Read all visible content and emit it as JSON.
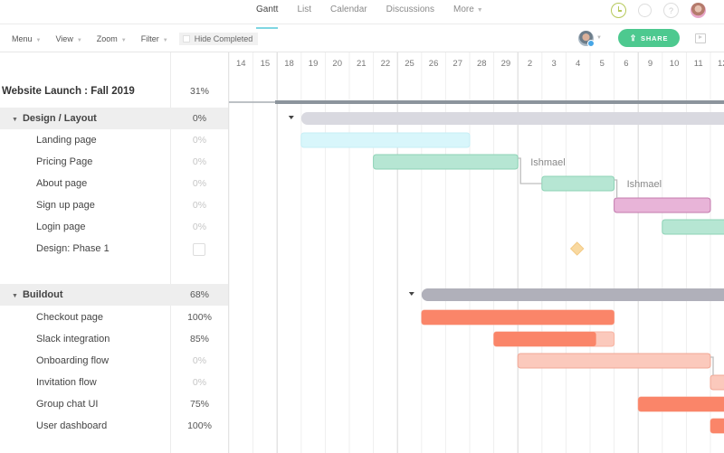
{
  "nav": {
    "tabs": [
      {
        "label": "Gantt",
        "active": true
      },
      {
        "label": "List",
        "active": false
      },
      {
        "label": "Calendar",
        "active": false
      },
      {
        "label": "Discussions",
        "active": false
      },
      {
        "label": "More",
        "active": false,
        "dropdown": true
      }
    ],
    "icons": [
      "clock-icon",
      "search-icon",
      "help-icon",
      "user-avatar"
    ],
    "help_glyph": "?"
  },
  "toolbar": {
    "menus": [
      "Menu",
      "View",
      "Zoom",
      "Filter"
    ],
    "hide_completed_label": "Hide Completed",
    "hide_completed_checked": false,
    "share_label": "SHARE",
    "share_color": "#4dc98f"
  },
  "timeline": {
    "days": [
      "14",
      "15",
      "18",
      "19",
      "20",
      "21",
      "22",
      "25",
      "26",
      "27",
      "28",
      "29",
      "2",
      "3",
      "4",
      "5",
      "6",
      "9",
      "10",
      "11",
      "12"
    ],
    "week_starts": [
      2,
      7,
      12,
      17
    ]
  },
  "project": {
    "name": "Website Launch : Fall 2019",
    "percent": "31%"
  },
  "groups": [
    {
      "name": "Design / Layout",
      "percent": "0%",
      "bar": {
        "start": 3,
        "end": 21,
        "color": "#d9d9e0"
      },
      "tasks": [
        {
          "name": "Landing page",
          "percent": "0%",
          "muted": true,
          "bar": {
            "start": 3,
            "end": 10,
            "fill": "#d8f6fb",
            "stroke": "#c6eef6",
            "progress": 0
          }
        },
        {
          "name": "Pricing Page",
          "percent": "0%",
          "muted": true,
          "bar": {
            "start": 6,
            "end": 12,
            "fill": "#b6e6d3",
            "stroke": "#8dd3b6",
            "progress": 0
          },
          "assignee": "Ishmael"
        },
        {
          "name": "About page",
          "percent": "0%",
          "muted": true,
          "bar": {
            "start": 13,
            "end": 16,
            "fill": "#b6e6d3",
            "stroke": "#8dd3b6",
            "progress": 0
          },
          "assignee": "Ishmael"
        },
        {
          "name": "Sign up page",
          "percent": "0%",
          "muted": true,
          "bar": {
            "start": 16,
            "end": 20,
            "fill": "#e8b4d8",
            "stroke": "#c37aad",
            "progress": 0
          }
        },
        {
          "name": "Login page",
          "percent": "0%",
          "muted": true,
          "bar": {
            "start": 18,
            "end": 21,
            "fill": "#b6e6d3",
            "stroke": "#8dd3b6",
            "progress": 0
          }
        },
        {
          "name": "Design: Phase 1",
          "percent": "",
          "milestone": true,
          "milestone_day": 14.5,
          "milestone_color": "#f9d9a0"
        }
      ]
    },
    {
      "name": "Buildout",
      "percent": "68%",
      "bar": {
        "start": 8,
        "end": 21,
        "color": "#b0b0ba"
      },
      "tasks": [
        {
          "name": "Checkout page",
          "percent": "100%",
          "muted": false,
          "bar": {
            "start": 8,
            "end": 16,
            "fill": "#fbc9bc",
            "stroke": "#f7b3a2",
            "progress": 1.0,
            "progress_color": "#fa8569"
          }
        },
        {
          "name": "Slack integration",
          "percent": "85%",
          "muted": false,
          "bar": {
            "start": 11,
            "end": 16,
            "fill": "#fbc9bc",
            "stroke": "#f7b3a2",
            "progress": 0.85,
            "progress_color": "#fa8569"
          }
        },
        {
          "name": "Onboarding flow",
          "percent": "0%",
          "muted": true,
          "bar": {
            "start": 12,
            "end": 20,
            "fill": "#fbc9bc",
            "stroke": "#f2a896",
            "progress": 0
          }
        },
        {
          "name": "Invitation flow",
          "percent": "0%",
          "muted": true,
          "bar": {
            "start": 20,
            "end": 22,
            "fill": "#fbc9bc",
            "stroke": "#f2a896",
            "progress": 0
          }
        },
        {
          "name": "Group chat UI",
          "percent": "75%",
          "muted": false,
          "bar": {
            "start": 17,
            "end": 22,
            "fill": "#fbc9bc",
            "stroke": "#f7b3a2",
            "progress": 1.0,
            "progress_color": "#fa8569"
          }
        },
        {
          "name": "User dashboard",
          "percent": "100%",
          "muted": false,
          "bar": {
            "start": 20,
            "end": 22,
            "fill": "#fbc9bc",
            "stroke": "#f7b3a2",
            "progress": 1.0,
            "progress_color": "#fa8569"
          }
        }
      ]
    }
  ],
  "dependencies": [
    {
      "from_group": 0,
      "from_task": 1,
      "to_group": 0,
      "to_task": 2
    },
    {
      "from_group": 0,
      "from_task": 2,
      "to_group": 0,
      "to_task": 3
    },
    {
      "from_group": 1,
      "from_task": 2,
      "to_group": 1,
      "to_task": 3
    }
  ],
  "project_bar_color": "#8c949c"
}
